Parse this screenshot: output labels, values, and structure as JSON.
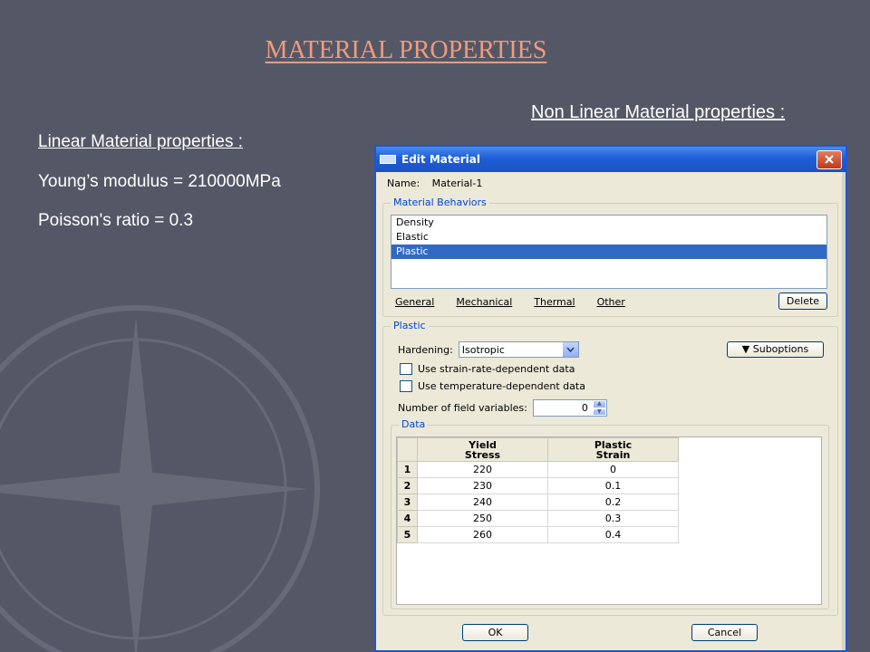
{
  "slide": {
    "title": "MATERIAL PROPERTIES",
    "nonlinear_heading": "Non Linear Material properties :",
    "linear_heading": "Linear Material properties :",
    "properties": [
      "Young’s modulus = 210000MPa",
      "Poisson's ratio = 0.3"
    ]
  },
  "dialog": {
    "title": "Edit Material",
    "name_label": "Name:",
    "name_value": "Material-1",
    "behaviors": {
      "label": "Material Behaviors",
      "items": [
        "Density",
        "Elastic",
        "Plastic"
      ],
      "selected": "Plastic",
      "menus": [
        "General",
        "Mechanical",
        "Thermal",
        "Other"
      ],
      "delete_label": "Delete"
    },
    "plastic": {
      "label": "Plastic",
      "hardening_label": "Hardening:",
      "hardening_value": "Isotropic",
      "suboptions_label": "Suboptions",
      "strain_rate_label": "Use strain-rate-dependent data",
      "temperature_label": "Use temperature-dependent data",
      "field_vars_label": "Number of field variables:",
      "field_vars_value": "0",
      "data": {
        "label": "Data",
        "headers": [
          "Yield\nStress",
          "Plastic\nStrain"
        ],
        "rows": [
          {
            "num": "1",
            "yield": "220",
            "strain": "0"
          },
          {
            "num": "2",
            "yield": "230",
            "strain": "0.1"
          },
          {
            "num": "3",
            "yield": "240",
            "strain": "0.2"
          },
          {
            "num": "4",
            "yield": "250",
            "strain": "0.3"
          },
          {
            "num": "5",
            "yield": "260",
            "strain": "0.4"
          }
        ]
      }
    },
    "ok_label": "OK",
    "cancel_label": "Cancel"
  },
  "colors": {
    "background": "#545866",
    "title": "#f19a7e",
    "dialog_accent": "#2156c8",
    "selection": "#316ac5"
  },
  "icons": [
    "compass-watermark",
    "close-icon",
    "dropdown-arrow-icon",
    "triangle-down-icon",
    "spin-up-icon",
    "spin-down-icon"
  ]
}
